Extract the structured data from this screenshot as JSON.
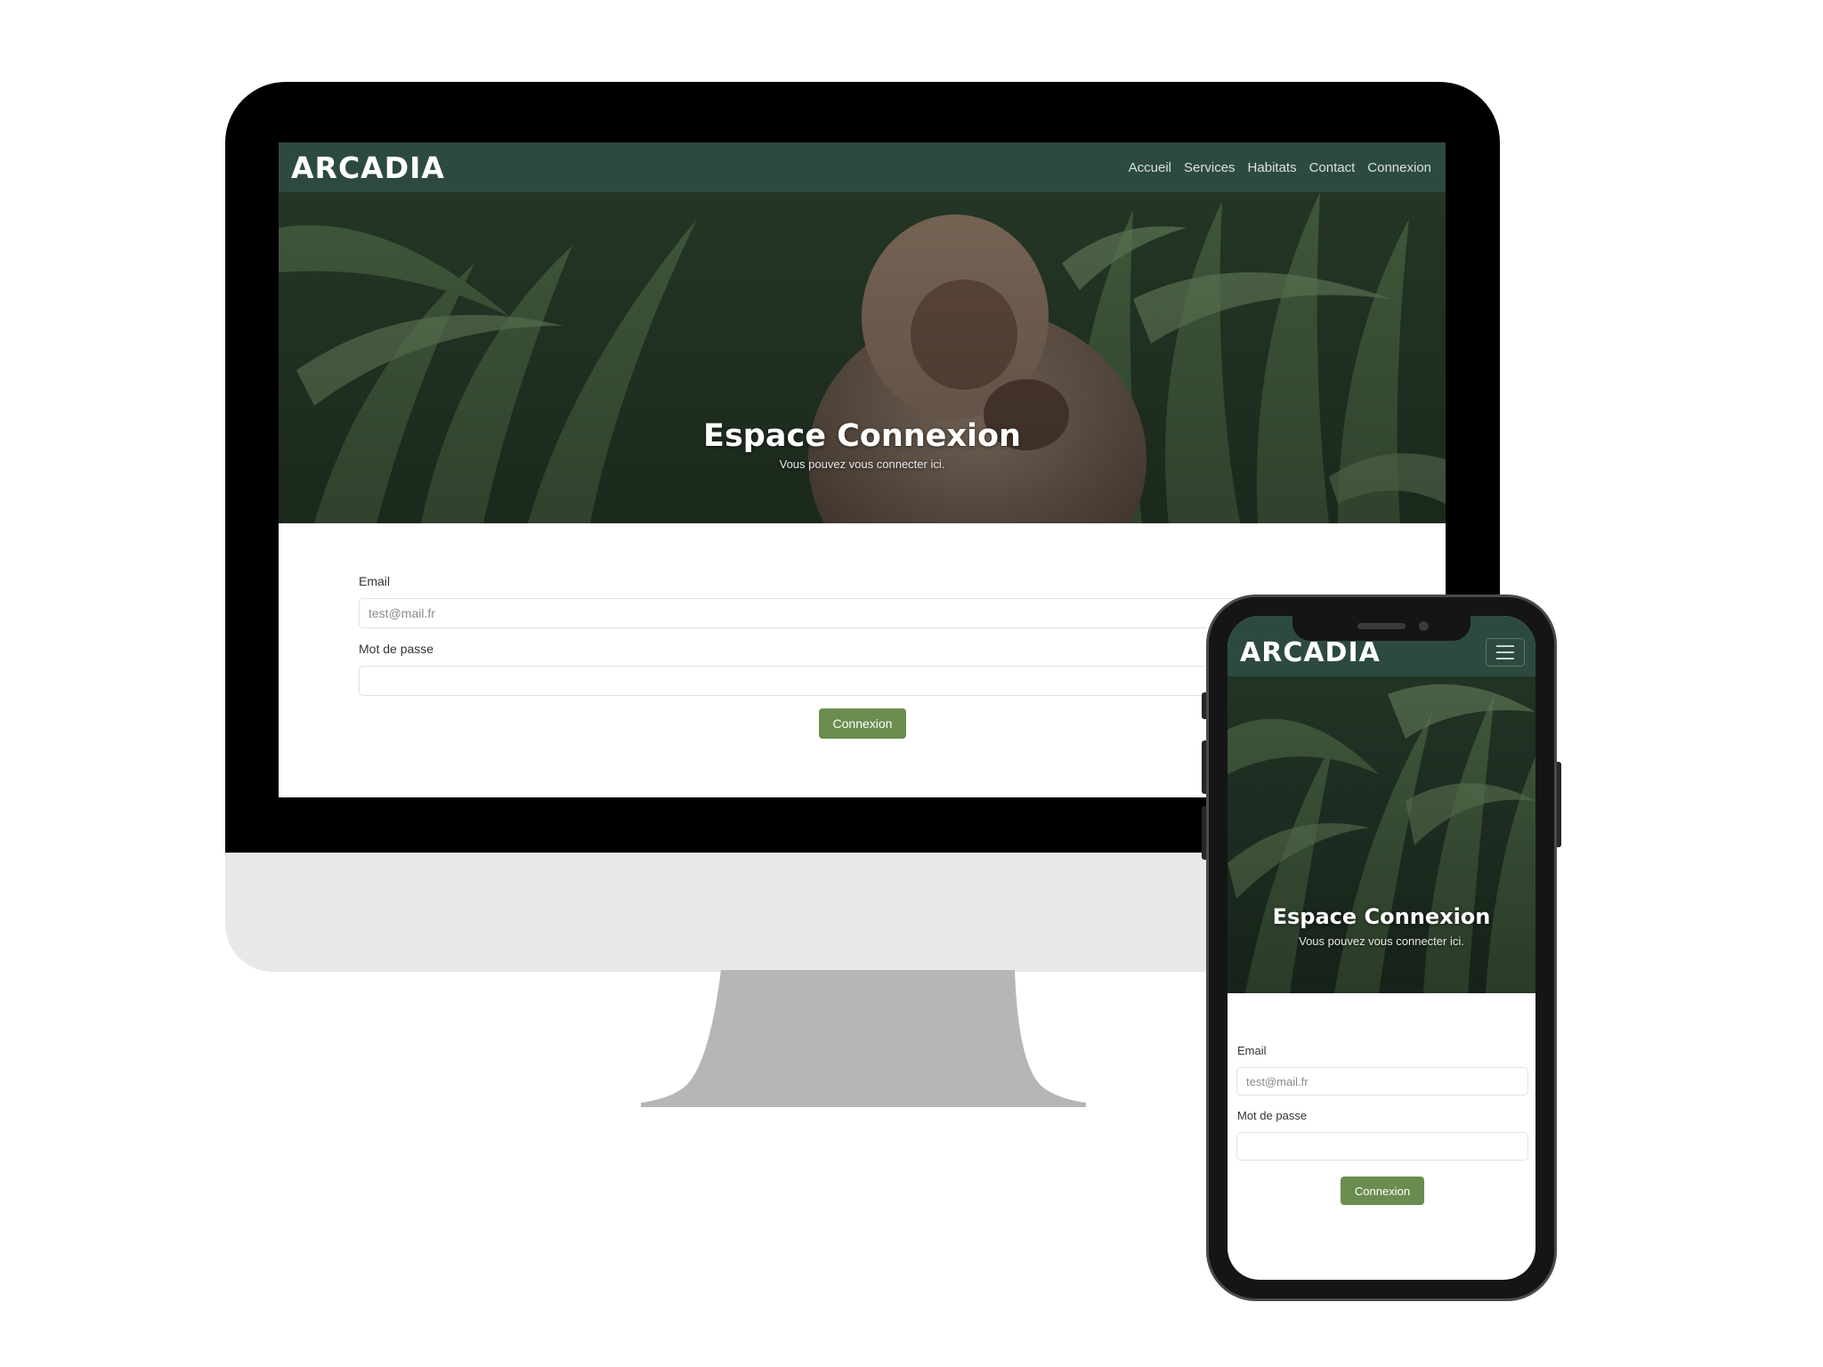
{
  "site": {
    "logo": "ARCADIA",
    "nav": [
      "Accueil",
      "Services",
      "Habitats",
      "Contact",
      "Connexion"
    ],
    "hero": {
      "title": "Espace Connexion",
      "subtitle": "Vous pouvez vous connecter ici."
    },
    "form": {
      "email_label": "Email",
      "email_placeholder": "test@mail.fr",
      "password_label": "Mot de passe",
      "password_placeholder": "",
      "submit_label": "Connexion"
    }
  },
  "colors": {
    "navbar": "#2d4a3e",
    "button": "#6a8d4f",
    "imac_chin": "#e8e8e8",
    "imac_stand": "#b6b6b6"
  },
  "icons": [
    "hamburger-menu-icon"
  ]
}
